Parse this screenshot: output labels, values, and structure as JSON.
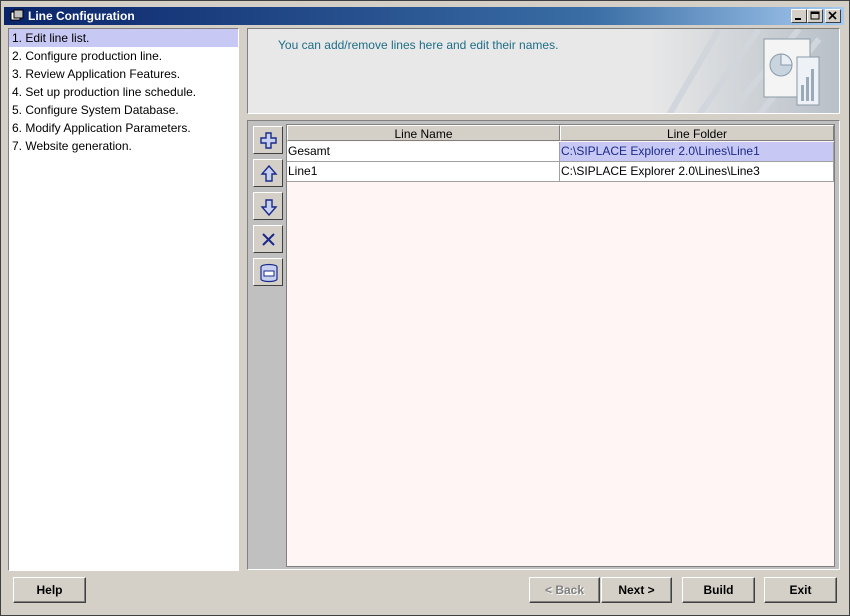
{
  "window": {
    "title": "Line Configuration"
  },
  "steps": [
    "1. Edit line list.",
    "2. Configure production line.",
    "3. Review Application Features.",
    "4. Set up production line schedule.",
    "5. Configure System Database.",
    "6. Modify Application Parameters.",
    "7. Website generation."
  ],
  "banner": {
    "message": "You can add/remove lines here and edit their names."
  },
  "table": {
    "columns": [
      "Line Name",
      "Line Folder"
    ],
    "rows": [
      {
        "name": "Gesamt",
        "folder": "C:\\SIPLACE Explorer 2.0\\Lines\\Line1",
        "selected": true
      },
      {
        "name": "Line1",
        "folder": "C:\\SIPLACE Explorer 2.0\\Lines\\Line3",
        "selected": false
      }
    ]
  },
  "toolbar": {
    "icons": [
      "add-icon",
      "move-up-icon",
      "move-down-icon",
      "delete-icon",
      "database-icon"
    ]
  },
  "buttons": {
    "help": "Help",
    "back": "< Back",
    "next": "Next >",
    "build": "Build",
    "exit": "Exit"
  }
}
